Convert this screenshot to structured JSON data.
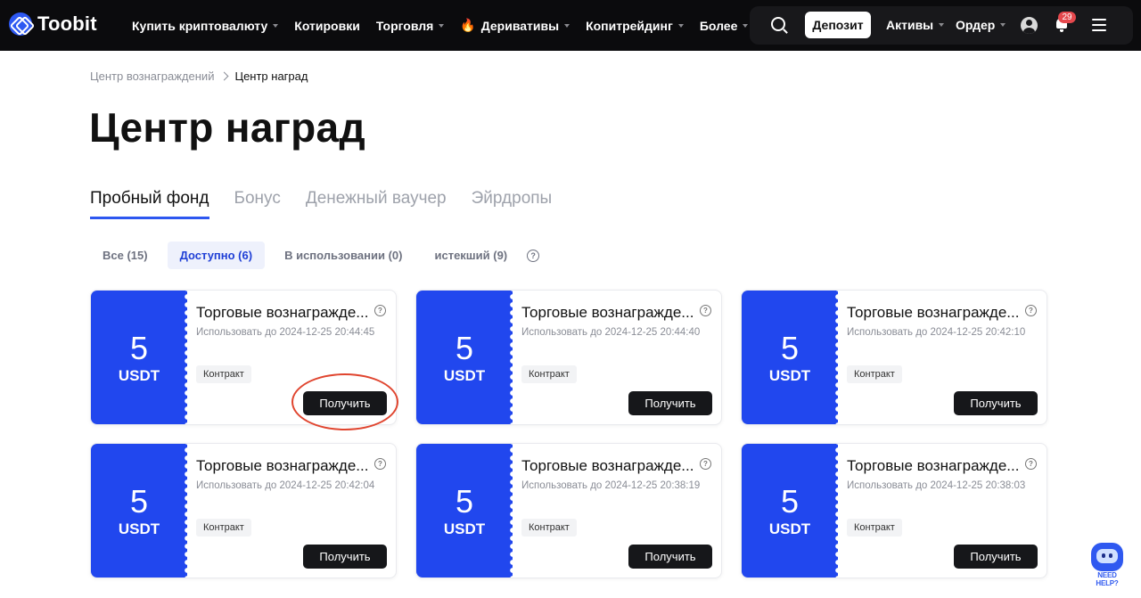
{
  "nav": {
    "logo": "Toobit",
    "menu": [
      {
        "label": "Купить криптовалюту",
        "caret": true
      },
      {
        "label": "Котировки",
        "caret": false
      },
      {
        "label": "Торговля",
        "caret": true
      },
      {
        "label": "Деривативы",
        "caret": true,
        "icon": "fire-icon"
      },
      {
        "label": "Копитрейдинг",
        "caret": true
      },
      {
        "label": "Более",
        "caret": true
      }
    ],
    "deposit": "Депозит",
    "assets": "Активы",
    "orders": "Ордер",
    "notifications": "29"
  },
  "breadcrumb": {
    "parent": "Центр вознаграждений",
    "current": "Центр наград"
  },
  "title": "Центр наград",
  "tabs": [
    "Пробный фонд",
    "Бонус",
    "Денежный ваучер",
    "Эйрдропы"
  ],
  "active_tab": "Пробный фонд",
  "filters": [
    "Все (15)",
    "Доступно (6)",
    "В использовании (0)",
    "истекший (9)"
  ],
  "active_filter": "Доступно (6)",
  "cards": [
    {
      "amount": "5",
      "unit": "USDT",
      "title": "Торговые вознагражде...",
      "date": "Использовать до 2024-12-25 20:44:45",
      "tag": "Контракт",
      "button": "Получить"
    },
    {
      "amount": "5",
      "unit": "USDT",
      "title": "Торговые вознагражде...",
      "date": "Использовать до 2024-12-25 20:44:40",
      "tag": "Контракт",
      "button": "Получить"
    },
    {
      "amount": "5",
      "unit": "USDT",
      "title": "Торговые вознагражде...",
      "date": "Использовать до 2024-12-25 20:42:10",
      "tag": "Контракт",
      "button": "Получить"
    },
    {
      "amount": "5",
      "unit": "USDT",
      "title": "Торговые вознагражде...",
      "date": "Использовать до 2024-12-25 20:42:04",
      "tag": "Контракт",
      "button": "Получить"
    },
    {
      "amount": "5",
      "unit": "USDT",
      "title": "Торговые вознагражде...",
      "date": "Использовать до 2024-12-25 20:38:19",
      "tag": "Контракт",
      "button": "Получить"
    },
    {
      "amount": "5",
      "unit": "USDT",
      "title": "Торговые вознагражде...",
      "date": "Использовать до 2024-12-25 20:38:03",
      "tag": "Контракт",
      "button": "Получить"
    }
  ],
  "help_bot": "NEED HELP?",
  "colors": {
    "accent": "#2147ee",
    "nav_bg": "#0b0b0d",
    "highlight": "#e0452f"
  }
}
